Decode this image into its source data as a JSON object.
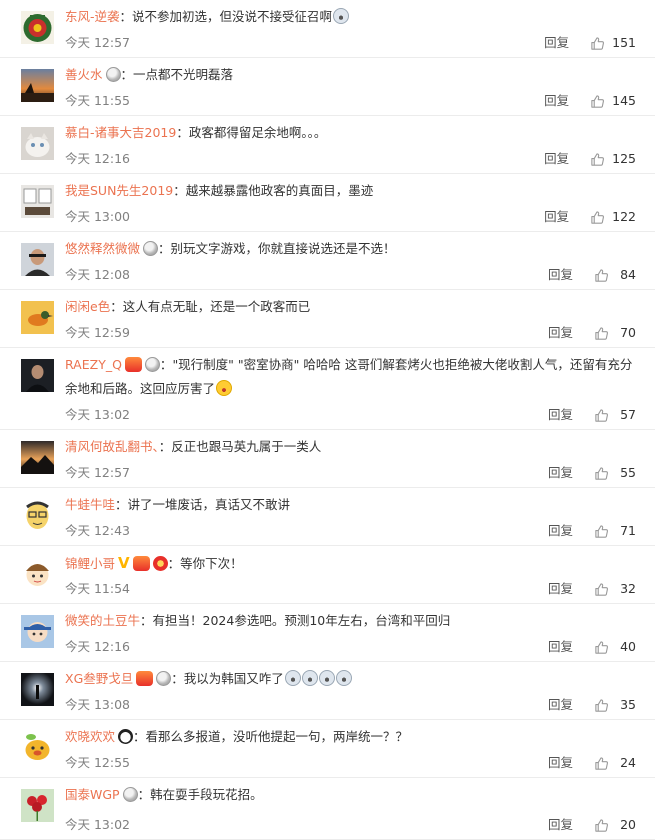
{
  "reply_label": "回复",
  "comments": [
    {
      "user": "东风-逆袭",
      "badges": [],
      "sep": "：",
      "text": "说不参加初选，但没说不接受征召啊",
      "emojis": [
        "scream"
      ],
      "time": "今天 12:57",
      "likes": "151",
      "avatar": "military"
    },
    {
      "user": "善火水",
      "badges": [
        "medal"
      ],
      "sep": "：",
      "text": "一点都不光明磊落",
      "emojis": [],
      "time": "今天 11:55",
      "likes": "145",
      "avatar": "sunset"
    },
    {
      "user": "慕白-诸事大吉2019",
      "badges": [],
      "sep": "：",
      "text": "政客都得留足余地啊。。。",
      "emojis": [],
      "time": "今天 12:16",
      "likes": "125",
      "avatar": "cat"
    },
    {
      "user": "我是SUN先生2019",
      "badges": [],
      "sep": "：",
      "text": "越来越暴露他政客的真面目，墨迹",
      "emojis": [],
      "time": "今天 13:00",
      "likes": "122",
      "avatar": "room"
    },
    {
      "user": "悠然释然微微",
      "badges": [
        "medal"
      ],
      "sep": "：",
      "text": "别玩文字游戏，你就直接说选还是不选！",
      "emojis": [],
      "time": "今天 12:08",
      "likes": "84",
      "avatar": "man"
    },
    {
      "user": "闲闲e色",
      "badges": [],
      "sep": "：",
      "text": "这人有点无耻，还是一个政客而已",
      "emojis": [],
      "time": "今天 12:59",
      "likes": "70",
      "avatar": "bird"
    },
    {
      "user": "RAEZY_Q",
      "badges": [
        "fire",
        "medal"
      ],
      "sep": "：",
      "text": "\"现行制度\" \"密室协商\" 哈哈哈 这哥们解套烤火也拒绝被大佬收割人气，还留有充分余地和后路。这回应厉害了",
      "emojis": [
        "laugh"
      ],
      "time": "今天 13:02",
      "likes": "57",
      "avatar": "dark"
    },
    {
      "user": "清风何故乱翻书、",
      "badges": [],
      "sep": "：",
      "text": "反正也跟马英九属于一类人",
      "emojis": [],
      "time": "今天 12:57",
      "likes": "55",
      "avatar": "mountain"
    },
    {
      "user": "牛蛙牛哇",
      "badges": [],
      "sep": "：",
      "text": "讲了一堆废话，真话又不敢讲",
      "emojis": [],
      "time": "今天 12:43",
      "likes": "71",
      "avatar": "cartoon"
    },
    {
      "user": "锦鲤小哥",
      "badges": [
        "v",
        "fire",
        "red"
      ],
      "sep": "：",
      "text": "等你下次！",
      "emojis": [],
      "time": "今天 11:54",
      "likes": "32",
      "avatar": "kid"
    },
    {
      "user": "微笑的土豆牛",
      "badges": [],
      "sep": "：",
      "text": "有担当！2024参选吧。预测10年左右，台湾和平回归",
      "emojis": [],
      "time": "今天 12:16",
      "likes": "40",
      "avatar": "doll"
    },
    {
      "user": "XG叁野戈旦",
      "badges": [
        "fire",
        "medal"
      ],
      "sep": "：",
      "text": "我以为韩国又咋了",
      "emojis": [
        "scream",
        "scream",
        "scream",
        "scream"
      ],
      "time": "今天 13:08",
      "likes": "35",
      "avatar": "light"
    },
    {
      "user": "欢晓欢欢",
      "badges": [
        "panda"
      ],
      "sep": "：",
      "text": "看那么多报道，没听他提起一句，两岸统一？？",
      "emojis": [],
      "time": "今天 12:55",
      "likes": "24",
      "avatar": "yellow"
    },
    {
      "user": "国泰WGP",
      "badges": [
        "medal"
      ],
      "sep": "：",
      "text": "韩在耍手段玩花招。",
      "emojis": [],
      "time": "今天 13:02",
      "likes": "20",
      "avatar": "flower"
    }
  ]
}
